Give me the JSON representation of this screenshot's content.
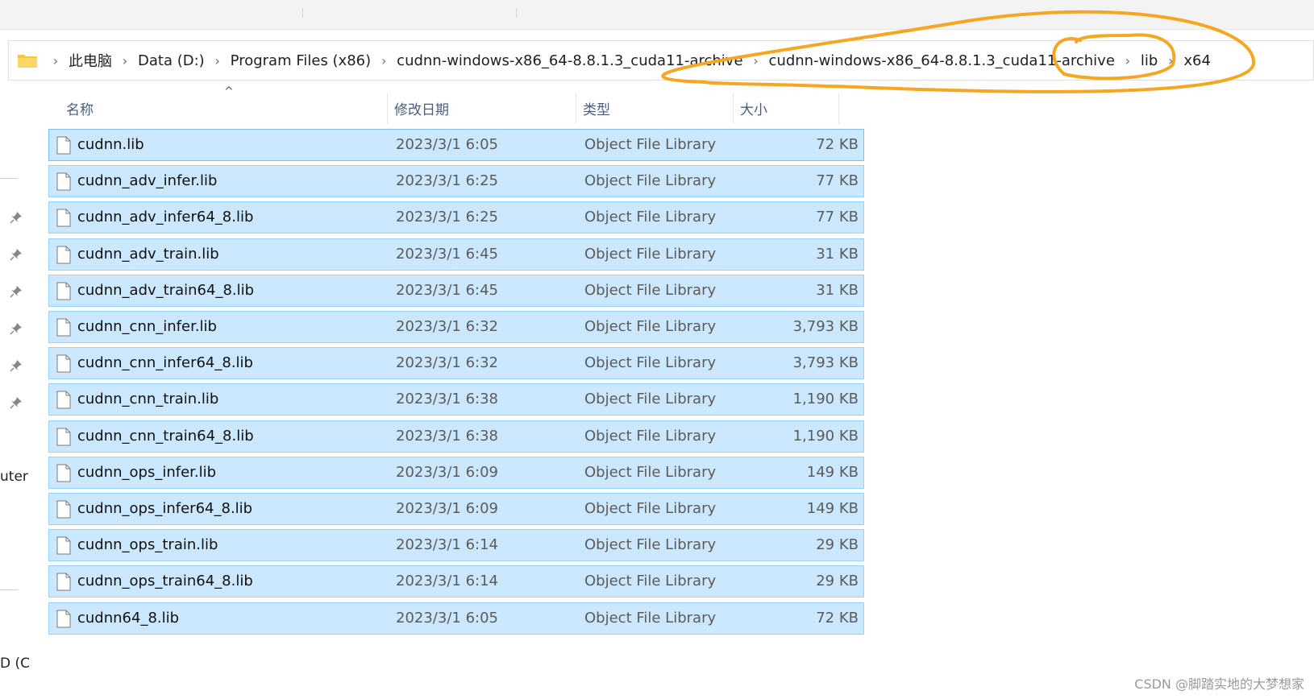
{
  "breadcrumb": {
    "items": [
      "此电脑",
      "Data (D:)",
      "Program Files (x86)",
      "cudnn-windows-x86_64-8.8.1.3_cuda11-archive",
      "cudnn-windows-x86_64-8.8.1.3_cuda11-archive",
      "lib",
      "x64"
    ]
  },
  "columns": {
    "name": "名称",
    "date": "修改日期",
    "type": "类型",
    "size": "大小"
  },
  "files": [
    {
      "name": "cudnn.lib",
      "date": "2023/3/1 6:05",
      "type": "Object File Library",
      "size": "72 KB"
    },
    {
      "name": "cudnn_adv_infer.lib",
      "date": "2023/3/1 6:25",
      "type": "Object File Library",
      "size": "77 KB"
    },
    {
      "name": "cudnn_adv_infer64_8.lib",
      "date": "2023/3/1 6:25",
      "type": "Object File Library",
      "size": "77 KB"
    },
    {
      "name": "cudnn_adv_train.lib",
      "date": "2023/3/1 6:45",
      "type": "Object File Library",
      "size": "31 KB"
    },
    {
      "name": "cudnn_adv_train64_8.lib",
      "date": "2023/3/1 6:45",
      "type": "Object File Library",
      "size": "31 KB"
    },
    {
      "name": "cudnn_cnn_infer.lib",
      "date": "2023/3/1 6:32",
      "type": "Object File Library",
      "size": "3,793 KB"
    },
    {
      "name": "cudnn_cnn_infer64_8.lib",
      "date": "2023/3/1 6:32",
      "type": "Object File Library",
      "size": "3,793 KB"
    },
    {
      "name": "cudnn_cnn_train.lib",
      "date": "2023/3/1 6:38",
      "type": "Object File Library",
      "size": "1,190 KB"
    },
    {
      "name": "cudnn_cnn_train64_8.lib",
      "date": "2023/3/1 6:38",
      "type": "Object File Library",
      "size": "1,190 KB"
    },
    {
      "name": "cudnn_ops_infer.lib",
      "date": "2023/3/1 6:09",
      "type": "Object File Library",
      "size": "149 KB"
    },
    {
      "name": "cudnn_ops_infer64_8.lib",
      "date": "2023/3/1 6:09",
      "type": "Object File Library",
      "size": "149 KB"
    },
    {
      "name": "cudnn_ops_train.lib",
      "date": "2023/3/1 6:14",
      "type": "Object File Library",
      "size": "29 KB"
    },
    {
      "name": "cudnn_ops_train64_8.lib",
      "date": "2023/3/1 6:14",
      "type": "Object File Library",
      "size": "29 KB"
    },
    {
      "name": "cudnn64_8.lib",
      "date": "2023/3/1 6:05",
      "type": "Object File Library",
      "size": "72 KB"
    }
  ],
  "sidebar": {
    "cut_label_1": "uter",
    "cut_label_2": "D (C"
  },
  "icons": {
    "folder": "folder-icon",
    "file": "file-icon",
    "pin": "pin-icon",
    "sort": "sort-up-icon"
  },
  "colors": {
    "selection": "#cce8ff",
    "selection_border": "#99d1ff",
    "annotation": "#f5a623"
  },
  "watermark": "CSDN @脚踏实地的大梦想家"
}
